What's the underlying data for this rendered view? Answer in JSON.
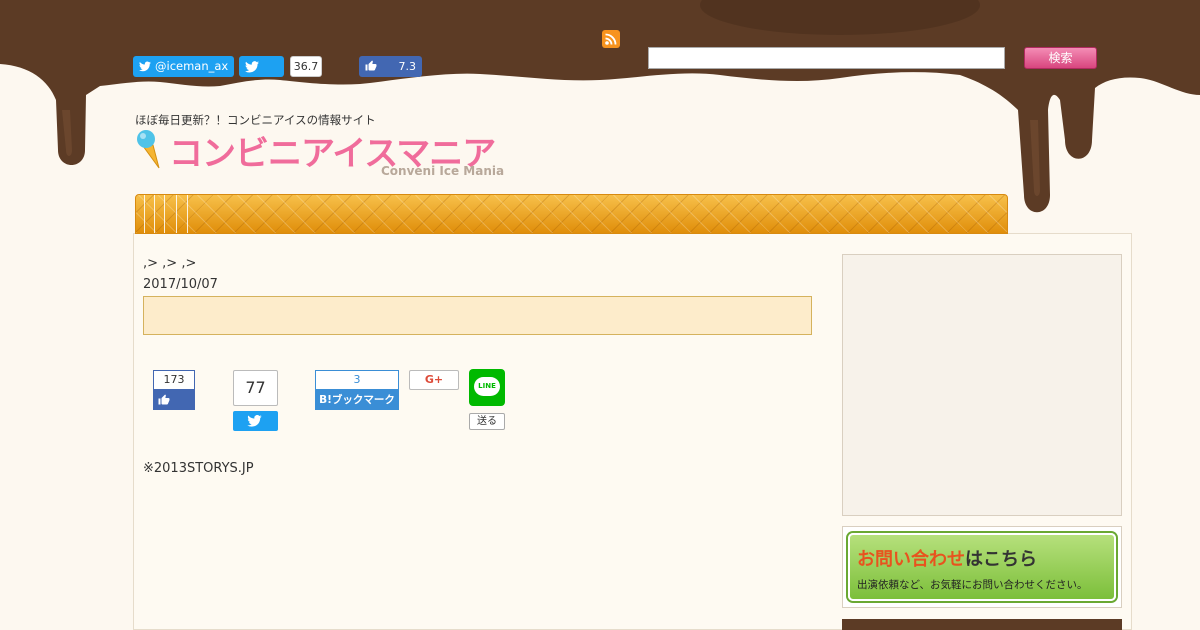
{
  "header": {
    "twitter_follow_label": "@iceman_ax",
    "tweet_count": "36.7",
    "fb_like_count": "7.3",
    "search_placeholder": "",
    "search_button_label": "検索"
  },
  "logo": {
    "tagline": "ほぼ毎日更新？！コンビニアイスの情報サイト",
    "title_jp": "コンビニアイスマニア",
    "title_en": "Conveni Ice Mania"
  },
  "article": {
    "breadcrumb": ",> ,> ,>",
    "date": "2017/10/07",
    "title": "",
    "share": {
      "fb_count": "173",
      "tweet_count": "77",
      "hatena_count": "3",
      "hatena_label": "B!ブックマーク",
      "gplus_label": "G+",
      "line_label": "LINE",
      "line_send_label": "送る"
    },
    "credit": "※2013STORYS.JP"
  },
  "sidebar": {
    "contact_title_main": "お問い合わせ",
    "contact_title_tail": "はこちら",
    "contact_sub": "出演依頼など、お気軽にお問い合わせください。"
  },
  "colors": {
    "chocolate": "#5c3b25",
    "cream": "#fdf8f0",
    "pink_accent": "#f06c9b",
    "wafer_orange": "#f0a820",
    "contact_green": "#7cbf3a"
  }
}
